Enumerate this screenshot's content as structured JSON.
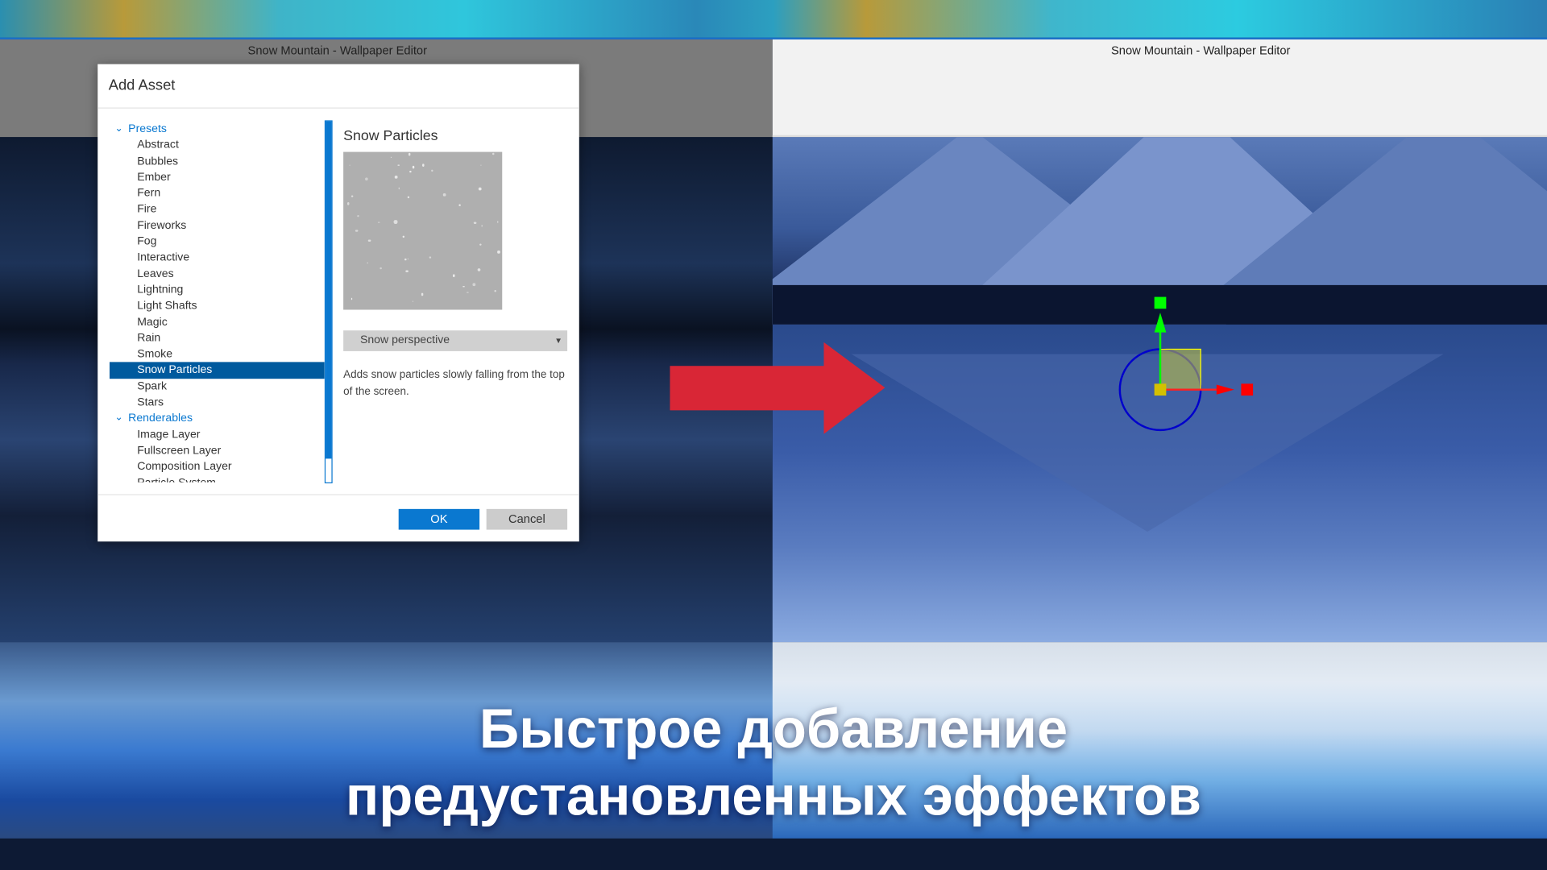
{
  "window_title_left": "Snow Mountain - Wallpaper Editor",
  "window_title_right": "Snow Mountain - Wallpaper Editor",
  "dialog": {
    "title": "Add Asset",
    "groups": [
      {
        "label": "Presets",
        "expanded": true,
        "items": [
          "Abstract",
          "Bubbles",
          "Ember",
          "Fern",
          "Fire",
          "Fireworks",
          "Fog",
          "Interactive",
          "Leaves",
          "Lightning",
          "Light Shafts",
          "Magic",
          "Rain",
          "Smoke",
          "Snow Particles",
          "Spark",
          "Stars"
        ]
      },
      {
        "label": "Renderables",
        "expanded": true,
        "items": [
          "Image Layer",
          "Fullscreen Layer",
          "Composition Layer",
          "Particle System"
        ]
      }
    ],
    "selected_item": "Snow Particles",
    "preview_title": "Snow Particles",
    "variant_select": "Snow perspective",
    "description": "Adds snow particles slowly falling from the top of the screen.",
    "ok_label": "OK",
    "cancel_label": "Cancel"
  },
  "caption": {
    "line1": "Быстрое добавление",
    "line2": "предустановленных эффектов"
  },
  "colors": {
    "accent": "#0a78d0",
    "selection": "#005a9e",
    "arrow": "#d92636",
    "gizmo_x": "#ff0000",
    "gizmo_y": "#00ff00",
    "gizmo_rotate": "#0000cc"
  }
}
